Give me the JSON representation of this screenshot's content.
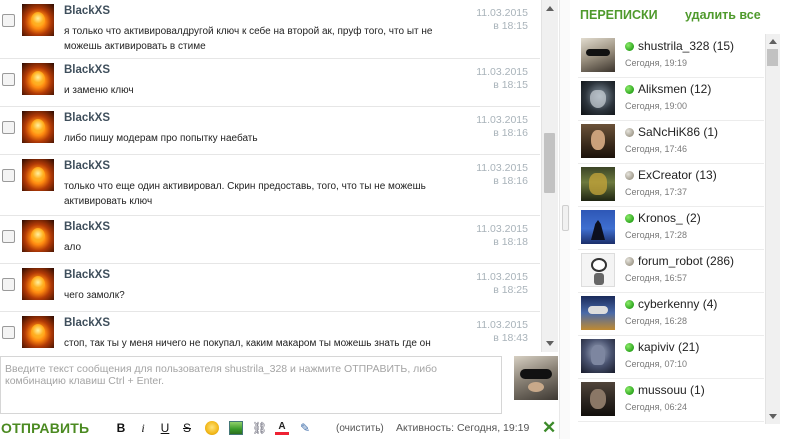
{
  "messages": [
    {
      "author": "BlackXS",
      "text": "я только что активировалдругой ключ к себе на второй ак, пруф того, что ыт не можешь активировать в стиме",
      "date": "11.03.2015",
      "time": "в 18:15"
    },
    {
      "author": "BlackXS",
      "text": "и заменю ключ",
      "date": "11.03.2015",
      "time": "в 18:15"
    },
    {
      "author": "BlackXS",
      "text": "либо пишу модерам про попытку наебать",
      "date": "11.03.2015",
      "time": "в 18:16"
    },
    {
      "author": "BlackXS",
      "text": "только что еще один активировал. Скрин предоставь, того, что ты не можешь активировать ключ",
      "date": "11.03.2015",
      "time": "в 18:16"
    },
    {
      "author": "BlackXS",
      "text": "ало",
      "date": "11.03.2015",
      "time": "в 18:18"
    },
    {
      "author": "BlackXS",
      "text": "чего замолк?",
      "date": "11.03.2015",
      "time": "в 18:25"
    },
    {
      "author": "BlackXS",
      "text": "стоп, так ты у меня ничего не покупал, каким макаром ты можешь знать где он",
      "date": "11.03.2015",
      "time": "в 18:43"
    }
  ],
  "composer": {
    "placeholder": "Введите текст сообщения для пользователя shustrila_328 и нажмите ОТПРАВИТЬ, либо комбинацию клавиш Ctrl + Enter."
  },
  "toolbar": {
    "send_label": "ОТПРАВИТЬ",
    "bold": "B",
    "italic": "i",
    "underline": "U",
    "strike": "S",
    "link_glyph": "⛓",
    "color_glyph": "A",
    "edit_glyph": "✎",
    "clear_label": "(очистить)",
    "activity": "Активность: Сегодня, 19:19",
    "close_glyph": "✕"
  },
  "sidebar": {
    "title": "ПЕРЕПИСКИ",
    "delete_all": "удалить все",
    "contacts": [
      {
        "name": "shustrila_328 (15)",
        "time": "Сегодня, 19:19",
        "status": "online",
        "avatar": "pug"
      },
      {
        "name": "Aliksmen (12)",
        "time": "Сегодня, 19:00",
        "status": "online",
        "avatar": "dark"
      },
      {
        "name": "SaNcHiK86 (1)",
        "time": "Сегодня, 17:46",
        "status": "away",
        "avatar": "man"
      },
      {
        "name": "ExCreator (13)",
        "time": "Сегодня, 17:37",
        "status": "away",
        "avatar": "soldier"
      },
      {
        "name": "Kronos_ (2)",
        "time": "Сегодня, 17:28",
        "status": "online",
        "avatar": "wolf"
      },
      {
        "name": "forum_robot (286)",
        "time": "Сегодня, 16:57",
        "status": "away",
        "avatar": "robot"
      },
      {
        "name": "cyberkenny (4)",
        "time": "Сегодня, 16:28",
        "status": "online",
        "avatar": "walle"
      },
      {
        "name": "kapiviv (21)",
        "time": "Сегодня, 07:10",
        "status": "online",
        "avatar": "knight"
      },
      {
        "name": "mussouu (1)",
        "time": "Сегодня, 06:24",
        "status": "online",
        "avatar": "warrior"
      }
    ]
  },
  "colors": {
    "accent_green": "#4f9a2c",
    "online": "#2ea61f",
    "away": "#a39d8f",
    "author": "#3f4f5c",
    "date": "#a9b3ba"
  }
}
